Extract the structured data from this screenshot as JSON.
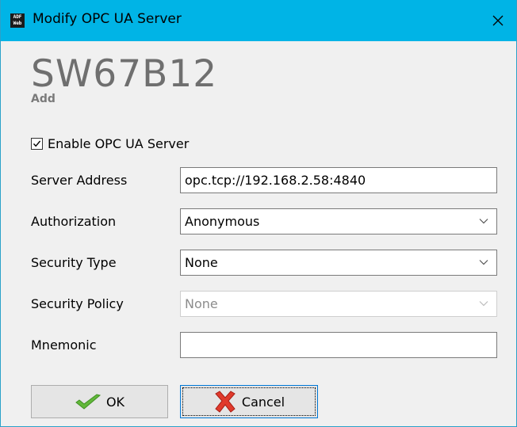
{
  "window": {
    "title": "Modify OPC UA Server",
    "app_icon_text": "ADF Web"
  },
  "header": {
    "product": "SW67B12",
    "subtitle": "Add"
  },
  "form": {
    "enable": {
      "label": "Enable OPC UA Server",
      "checked": true
    },
    "server_address": {
      "label": "Server Address",
      "value": "opc.tcp://192.168.2.58:4840"
    },
    "authorization": {
      "label": "Authorization",
      "value": "Anonymous"
    },
    "security_type": {
      "label": "Security Type",
      "value": "None"
    },
    "security_policy": {
      "label": "Security Policy",
      "value": "None",
      "disabled": true
    },
    "mnemonic": {
      "label": "Mnemonic",
      "value": ""
    }
  },
  "buttons": {
    "ok": "OK",
    "cancel": "Cancel"
  },
  "icons": {
    "close": "close-icon",
    "ok": "checkmark-icon",
    "cancel": "red-x-icon",
    "dropdown": "chevron-down-icon"
  }
}
